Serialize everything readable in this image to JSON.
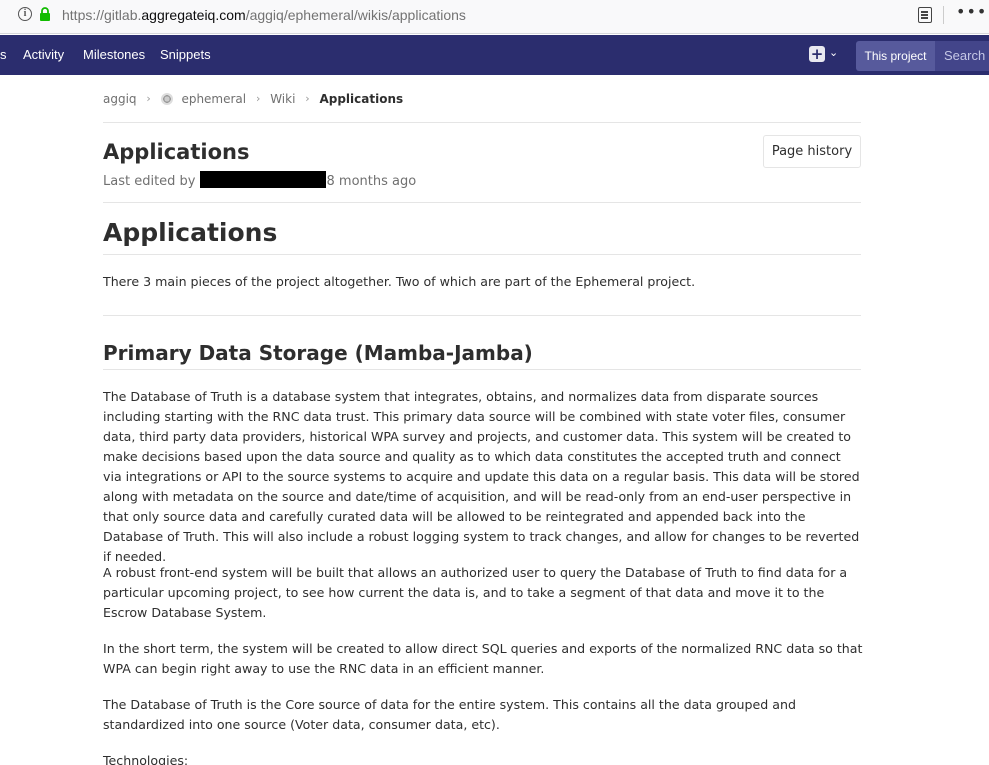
{
  "browser": {
    "url_prefix": "https://gitlab.",
    "url_domain": "aggregateiq.com",
    "url_path": "/aggiq/ephemeral/wikis/applications"
  },
  "navbar": {
    "edge_item": "s",
    "links": [
      "Activity",
      "Milestones",
      "Snippets"
    ],
    "new_icon": "+",
    "scope_button": "This project",
    "search_placeholder": "Search"
  },
  "breadcrumbs": {
    "group": "aggiq",
    "project": "ephemeral",
    "section": "Wiki",
    "current": "Applications"
  },
  "page": {
    "title": "Applications",
    "last_edited_prefix": "Last edited by",
    "last_edited_time": "8 months ago",
    "history_button": "Page history"
  },
  "article": {
    "h1": "Applications",
    "intro": "There 3 main pieces of the project altogether. Two of which are part of the Ephemeral project.",
    "h2": "Primary Data Storage (Mamba-Jamba)",
    "p1": "The Database of Truth is a database system that integrates, obtains, and normalizes data from disparate sources including starting with the RNC data trust. This primary data source will be combined with state voter files, consumer data, third party data providers, historical WPA survey and projects, and customer data. This system will be created to make decisions based upon the data source and quality as to which data constitutes the accepted truth and connect via integrations or API to the source systems to acquire and update this data on a regular basis. This data will be stored along with metadata on the source and date/time of acquisition, and will be read-only from an end-user perspective in that only source data and carefully curated data will be allowed to be reintegrated and appended back into the Database of Truth. This will also include a robust logging system to track changes, and allow for changes to be reverted if needed.",
    "p2": "A robust front-end system will be built that allows an authorized user to query the Database of Truth to find data for a particular upcoming project, to see how current the data is, and to take a segment of that data and move it to the Escrow Database System.",
    "p3": "In the short term, the system will be created to allow direct SQL queries and exports of the normalized RNC data so that WPA can begin right away to use the RNC data in an efficient manner.",
    "p4": "The Database of Truth is the Core source of data for the entire system. This contains all the data grouped and standardized into one source (Voter data, consumer data, etc).",
    "p5": "Technologies:"
  }
}
